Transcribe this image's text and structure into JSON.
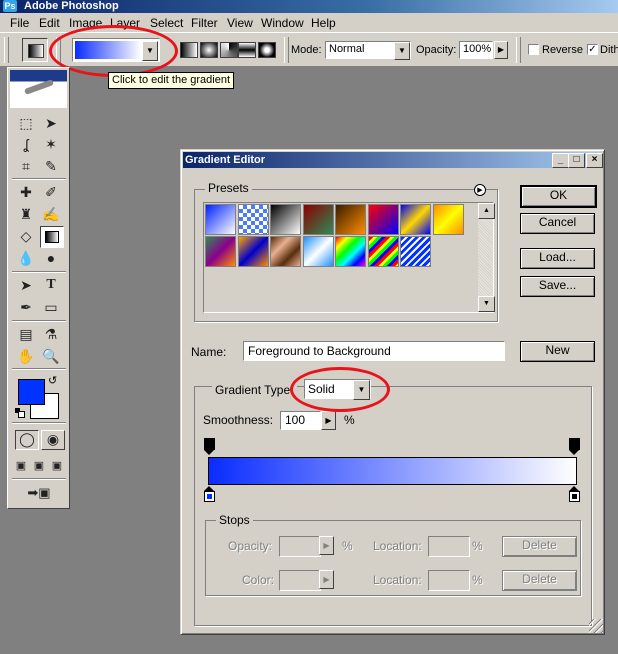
{
  "app": {
    "title": "Adobe Photoshop"
  },
  "menu": [
    "File",
    "Edit",
    "Image",
    "Layer",
    "Select",
    "Filter",
    "View",
    "Window",
    "Help"
  ],
  "options": {
    "tooltip": "Click to edit the gradient",
    "mode_label": "Mode:",
    "mode_value": "Normal",
    "opacity_label": "Opacity:",
    "opacity_value": "100%",
    "reverse_label": "Reverse",
    "dither_label": "Dith"
  },
  "colors": {
    "foreground": "#0033ff",
    "background": "#ffffff",
    "gradient_start": "#0a2cff",
    "gradient_end": "#ffffff",
    "annotation": "#e8141b"
  },
  "dialog": {
    "title": "Gradient Editor",
    "presets_label": "Presets",
    "ok": "OK",
    "cancel": "Cancel",
    "load": "Load...",
    "save": "Save...",
    "name_label": "Name:",
    "name_value": "Foreground to Background",
    "new_button": "New",
    "gradient_type_label": "Gradient Type:",
    "gradient_type_value": "Solid",
    "smoothness_label": "Smoothness:",
    "smoothness_value": "100",
    "percent": "%",
    "stops": {
      "label": "Stops",
      "opacity_label": "Opacity:",
      "color_label": "Color:",
      "location_label": "Location:",
      "percent": "%",
      "delete": "Delete"
    }
  }
}
